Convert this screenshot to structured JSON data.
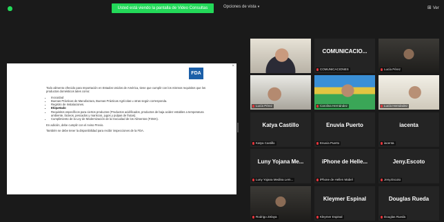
{
  "window": {
    "share_banner": "Usted está viendo la pantalla de Video Consultas",
    "view_options_label": "Opciones de vista",
    "view_button_label": "Ver"
  },
  "slide": {
    "logo_text": "FDA",
    "close_glyph": "×",
    "intro": "Todo alimento ofrecido para Importación en Estados Unidos de América, tiene que cumplir con los mismos requisitos que los productos domésticos tales como:",
    "bullets": [
      {
        "text": "Inocuidad",
        "strong": false
      },
      {
        "text": "Buenas Prácticas de Manufactura, Buenas Prácticas Agrícolas u otras según corresponda.",
        "strong": false
      },
      {
        "text": "Registro de Instalaciones.",
        "strong": false
      },
      {
        "text": "Etiquetado",
        "strong": true
      },
      {
        "text": "Requisitos específicos para ciertos productos (Productos acidificados, productos de baja acidez estables a temperatura ambiente, lácteos, pescados y mariscos, jugos y pulpas de frutas).",
        "strong": false
      },
      {
        "text": "Cumplimiento de la Ley de Modernización de la Inocuidad de los Alimentos (FSMA).",
        "strong": false
      }
    ],
    "closing_1": "En adición, debe cumplir con el Aviso Previo.",
    "closing_2": "También se debe tener la disponibilidad para recibir inspecciones de la FDA."
  },
  "participants": [
    {
      "name": "",
      "label": "",
      "video": "webcam-glasses-man",
      "active": true
    },
    {
      "name": "COMUNICACIO...",
      "label": "COMUNICACIONES",
      "video": null,
      "active": false
    },
    {
      "name": "",
      "label": "Lucía Pérez",
      "video": "dark-room",
      "active": false
    },
    {
      "name": "",
      "label": "Lucía Pérez",
      "video": "webcam-room",
      "active": false
    },
    {
      "name": "",
      "label": "Carolina Hernández",
      "video": "colorful-background",
      "active": false
    },
    {
      "name": "",
      "label": "Lucía Hernández",
      "video": "bright-room",
      "active": false
    },
    {
      "name": "Katya Castillo",
      "label": "Katya Castillo",
      "video": null,
      "active": false
    },
    {
      "name": "Enuvia Puerto",
      "label": "Enuvia Puerto",
      "video": null,
      "active": false
    },
    {
      "name": "iacenta",
      "label": "iacenta",
      "video": null,
      "active": false
    },
    {
      "name": "Luny Yojana Me...",
      "label": "Luny Yojana Medina Lem...",
      "video": null,
      "active": false
    },
    {
      "name": "iPhone de Helle...",
      "label": "iPhone de Hellen Mabel",
      "video": null,
      "active": false
    },
    {
      "name": "Jeny.Escoto",
      "label": "Jeny.Escoto",
      "video": null,
      "active": false
    },
    {
      "name": "",
      "label": "Rodrigo Zelaya",
      "video": "dark-room",
      "active": false
    },
    {
      "name": "Kleymer Espinal",
      "label": "Kleymer Espinal",
      "video": null,
      "active": false
    },
    {
      "name": "Douglas Rueda",
      "label": "Douglas Rueda",
      "video": null,
      "active": false
    }
  ]
}
